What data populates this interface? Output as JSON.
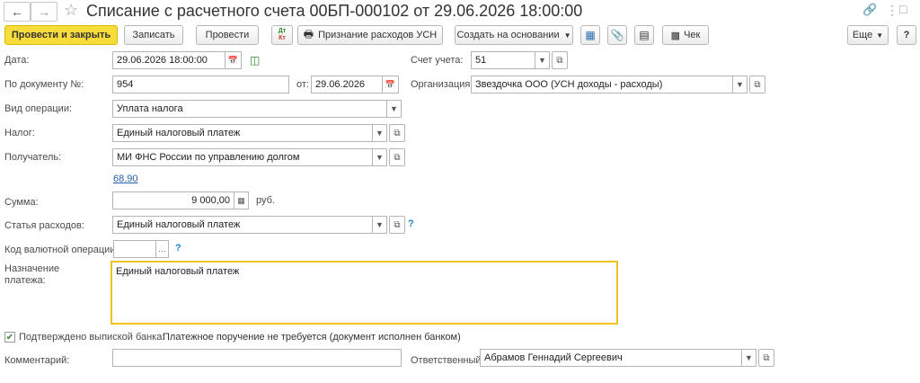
{
  "header": {
    "title": "Списание с расчетного счета 00БП-000102 от 29.06.2026 18:00:00",
    "back_icon": "arrow-left-icon",
    "forward_icon": "arrow-right-icon"
  },
  "toolbar": {
    "post_and_close": "Провести и закрыть",
    "save": "Записать",
    "post": "Провести",
    "dtkt_top": "Дт",
    "dtkt_bottom": "Кт",
    "recognize_expenses": "Признание расходов УСН",
    "create_based_on": "Создать на основании",
    "check": "Чек",
    "more": "Еще",
    "help": "?"
  },
  "form": {
    "date_label": "Дата:",
    "date_value": "29.06.2026 18:00:00",
    "account_label": "Счет учета:",
    "account_value": "51",
    "doc_no_label": "По документу №:",
    "doc_no_value": "954",
    "from_label": "от:",
    "from_value": "29.06.2026",
    "org_label": "Организация:",
    "org_value": "Звездочка ООО (УСН доходы - расходы)",
    "op_type_label": "Вид операции:",
    "op_type_value": "Уплата налога",
    "tax_label": "Налог:",
    "tax_value": "Единый налоговый платеж",
    "recipient_label": "Получатель:",
    "recipient_value": "МИ ФНС России по управлению долгом",
    "account_link": "68.90",
    "sum_label": "Сумма:",
    "sum_value": "9 000,00",
    "currency": "руб.",
    "expense_label": "Статья расходов:",
    "expense_value": "Единый налоговый платеж",
    "currency_code_label": "Код валютной операции:",
    "currency_code_value": "",
    "purpose_label_1": "Назначение",
    "purpose_label_2": "платежа:",
    "purpose_value": "Единый налоговый платеж",
    "confirmed_label": "Подтверждено выпиской банка:",
    "confirmed_checked": true,
    "confirmed_note": "Платежное поручение не требуется (документ исполнен банком)",
    "comment_label": "Комментарий:",
    "comment_value": "",
    "responsible_label": "Ответственный:",
    "responsible_value": "Абрамов Геннадий Сергеевич"
  }
}
